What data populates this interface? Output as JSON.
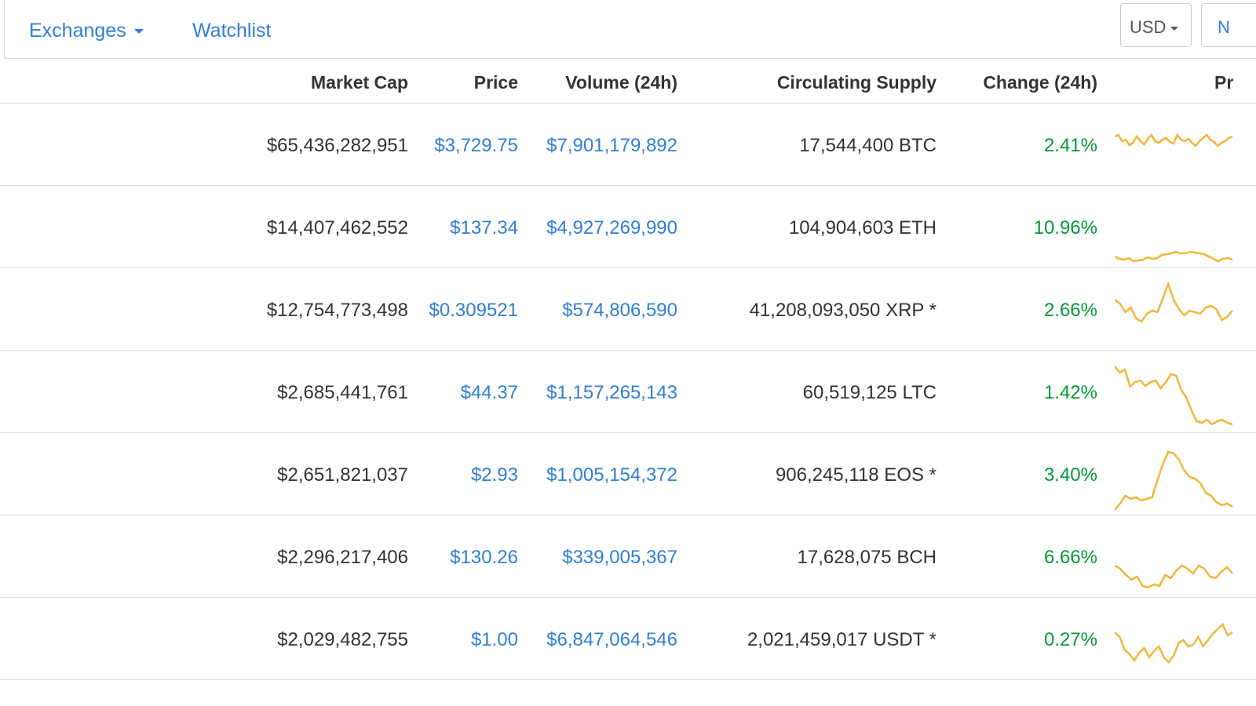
{
  "nav": {
    "exchanges_label": "Exchanges",
    "watchlist_label": "Watchlist",
    "currency_label": "USD",
    "next_label": "N"
  },
  "table": {
    "headers": {
      "market_cap": "Market Cap",
      "price": "Price",
      "volume": "Volume (24h)",
      "supply": "Circulating Supply",
      "change": "Change (24h)",
      "graph": "Pr"
    },
    "rows": [
      {
        "market_cap": "$65,436,282,951",
        "price": "$3,729.75",
        "volume": "$7,901,179,892",
        "supply": "17,544,400 BTC",
        "change": "2.41%"
      },
      {
        "market_cap": "$14,407,462,552",
        "price": "$137.34",
        "volume": "$4,927,269,990",
        "supply": "104,904,603 ETH",
        "change": "10.96%"
      },
      {
        "market_cap": "$12,754,773,498",
        "price": "$0.309521",
        "volume": "$574,806,590",
        "supply": "41,208,093,050 XRP *",
        "change": "2.66%"
      },
      {
        "market_cap": "$2,685,441,761",
        "price": "$44.37",
        "volume": "$1,157,265,143",
        "supply": "60,519,125 LTC",
        "change": "1.42%"
      },
      {
        "market_cap": "$2,651,821,037",
        "price": "$2.93",
        "volume": "$1,005,154,372",
        "supply": "906,245,118 EOS *",
        "change": "3.40%"
      },
      {
        "market_cap": "$2,296,217,406",
        "price": "$130.26",
        "volume": "$339,005,367",
        "supply": "17,628,075 BCH",
        "change": "6.66%"
      },
      {
        "market_cap": "$2,029,482,755",
        "price": "$1.00",
        "volume": "$6,847,064,546",
        "supply": "2,021,459,017 USDT *",
        "change": "0.27%"
      }
    ]
  },
  "colors": {
    "link": "#2f7ed8",
    "positive": "#093",
    "sparkline": "#f2b63a",
    "border": "#dddddd"
  },
  "icons": {
    "dropdown": "chevron-down-icon"
  }
}
